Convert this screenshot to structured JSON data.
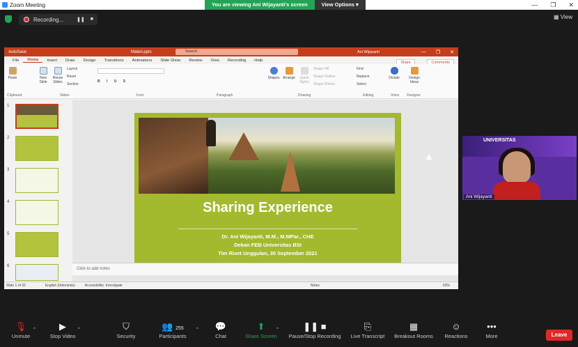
{
  "window": {
    "title": "Zoom Meeting"
  },
  "banner": {
    "message": "You are viewing Ani Wijayanti's screen",
    "view_options": "View Options"
  },
  "topbar": {
    "recording": "Recording...",
    "view": "View"
  },
  "ppt": {
    "autosave": "AutoSave",
    "filename": "Materi.pptx",
    "search": "Search",
    "user": "Ani Wijayanti",
    "menu": [
      "File",
      "Home",
      "Insert",
      "Draw",
      "Design",
      "Transitions",
      "Animations",
      "Slide Show",
      "Review",
      "View",
      "Recording",
      "Help"
    ],
    "share": "Share",
    "comments": "Comments",
    "ribbon": {
      "paste": "Paste",
      "new_slide": "New Slide",
      "reuse": "Reuse Slides",
      "layout": "Layout",
      "reset": "Reset",
      "section": "Section",
      "shapes": "Shapes",
      "arrange": "Arrange",
      "quick_styles": "Quick Styles",
      "shape_fill": "Shape Fill",
      "shape_outline": "Shape Outline",
      "shape_effects": "Shape Effects",
      "find": "Find",
      "replace": "Replace",
      "select": "Select",
      "dictate": "Dictate",
      "design_ideas": "Design Ideas",
      "groups": [
        "Clipboard",
        "Slides",
        "Font",
        "Paragraph",
        "Drawing",
        "Editing",
        "Voice",
        "Designer"
      ]
    },
    "thumbs": [
      "1",
      "2",
      "3",
      "4",
      "5",
      "6"
    ],
    "slide": {
      "title": "Sharing Experience",
      "line1": "Dr. Ani Wijayanti, M.M., M.MPar., CHE",
      "line2": "Dekan FEB Universitas BSI",
      "line3": "Tim Riset Unggulan, 30 September 2021"
    },
    "notes": "Click to add notes",
    "status": {
      "slide": "Slide 1 of 32",
      "lang": "English (Indonesia)",
      "access": "Accessibility: Investigate",
      "notes": "Notes",
      "zoom": "63%"
    }
  },
  "gallery": {
    "name": "Ani Wijayanti",
    "header": "UNIVERSITAS"
  },
  "toolbar": [
    {
      "label": "Unmute",
      "icon": "mic-off-icon"
    },
    {
      "label": "Stop Video",
      "icon": "video-icon"
    },
    {
      "label": "Security",
      "icon": "shield-icon"
    },
    {
      "label": "Participants",
      "icon": "participants-icon",
      "count": "255"
    },
    {
      "label": "Chat",
      "icon": "chat-icon"
    },
    {
      "label": "Share Screen",
      "icon": "share-screen-icon"
    },
    {
      "label": "Pause/Stop Recording",
      "icon": "record-icon"
    },
    {
      "label": "Live Transcript",
      "icon": "cc-icon"
    },
    {
      "label": "Breakout Rooms",
      "icon": "breakout-icon"
    },
    {
      "label": "Reactions",
      "icon": "reactions-icon"
    },
    {
      "label": "More",
      "icon": "more-icon"
    }
  ],
  "leave": "Leave"
}
